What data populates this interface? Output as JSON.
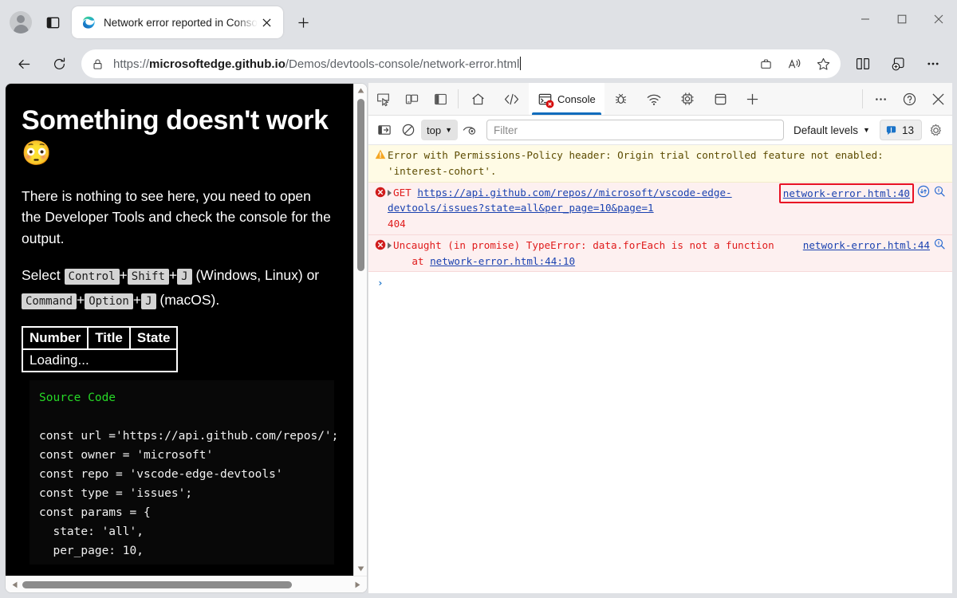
{
  "browser": {
    "profile_icon": "profile-avatar-icon",
    "tab_search_icon": "tab-panel-icon",
    "tab": {
      "favicon": "edge-logo-icon",
      "title": "Network error reported in Conso",
      "close_icon": "close-icon"
    },
    "new_tab_label": "+",
    "window_controls": {
      "minimize": "minimize-icon",
      "maximize": "maximize-icon",
      "close": "close-icon"
    },
    "nav": {
      "back_icon": "back-arrow-icon",
      "reload_icon": "reload-icon",
      "lock_icon": "lock-icon",
      "url_full": "https://microsoftedge.github.io/Demos/devtools-console/network-error.html",
      "url_scheme": "https://",
      "url_domain": "microsoftedge.github.io",
      "url_path": "/Demos/devtools-console/network-error.html",
      "briefcase_icon": "briefcase-icon",
      "read_aloud_icon": "read-aloud-icon",
      "favorite_icon": "star-icon",
      "split_screen_icon": "split-screen-icon",
      "collections_icon": "collections-icon",
      "settings_more_icon": "more-ellipsis-icon"
    }
  },
  "page": {
    "heading": "Something doesn't work",
    "heading_emoji": "😳",
    "paragraph": "There is nothing to see here, you need to open the Developer Tools and check the console for the output.",
    "shortcut_prefix": "Select",
    "keys_windows": [
      "Control",
      "Shift",
      "J"
    ],
    "platform_windows": "(Windows, Linux)",
    "shortcut_or": "or",
    "keys_mac": [
      "Command",
      "Option",
      "J"
    ],
    "platform_mac": "(macOS).",
    "table": {
      "headers": [
        "Number",
        "Title",
        "State"
      ],
      "loading_row": "Loading..."
    },
    "source_code_label": "Source Code",
    "source_code": "const url ='https://api.github.com/repos/';\nconst owner = 'microsoft'\nconst repo = 'vscode-edge-devtools'\nconst type = 'issues';\nconst params = {\n  state: 'all',\n  per_page: 10,"
  },
  "devtools": {
    "left_tools": [
      {
        "name": "inspect-element-icon",
        "label": "Inspect"
      },
      {
        "name": "device-emulation-icon",
        "label": "Device emulation"
      },
      {
        "name": "toggle-sidebar-icon",
        "label": "Toggle sidebar"
      }
    ],
    "tabs": [
      {
        "name": "tab-welcome",
        "icon": "home-icon",
        "label": ""
      },
      {
        "name": "tab-elements",
        "icon": "code-icon",
        "label": ""
      },
      {
        "name": "tab-console",
        "icon": "console-icon",
        "label": "Console",
        "selected": true,
        "badge": "error"
      },
      {
        "name": "tab-sources",
        "icon": "bug-icon",
        "label": ""
      },
      {
        "name": "tab-network",
        "icon": "network-icon",
        "label": ""
      },
      {
        "name": "tab-performance",
        "icon": "cpu-icon",
        "label": ""
      },
      {
        "name": "tab-application",
        "icon": "application-icon",
        "label": ""
      },
      {
        "name": "tab-more-panels",
        "icon": "plus-icon",
        "label": ""
      }
    ],
    "tabbar_right": [
      {
        "name": "more-tools-icon",
        "label": "..."
      },
      {
        "name": "help-icon",
        "label": "?"
      },
      {
        "name": "close-devtools-icon",
        "label": "X"
      }
    ],
    "filterbar": {
      "sidebar_toggle_icon": "console-sidebar-icon",
      "clear_console_icon": "clear-console-icon",
      "context_value": "top",
      "context_caret": "▼",
      "live_expression_icon": "eye-icon",
      "filter_placeholder": "Filter",
      "filter_value": "",
      "levels_label": "Default levels",
      "levels_caret": "▼",
      "issues_icon": "issues-bubble-icon",
      "issues_count": "13",
      "settings_icon": "gear-icon"
    },
    "messages": [
      {
        "type": "warning",
        "icon": "warning-triangle-icon",
        "text": "Error with Permissions-Policy header: Origin trial controlled feature not enabled: 'interest-cohort'.",
        "source": "",
        "boxed": false
      },
      {
        "type": "error",
        "icon": "error-circle-icon",
        "method": "GET",
        "url": "https://api.github.com/repos//microsoft/vscode-edge-devtools/issues?state=all&per_page=10&page=1",
        "status": "404",
        "source": "network-error.html:40",
        "boxed": true,
        "info_icon": "network-info-icon",
        "search_icon": "search-issue-icon"
      },
      {
        "type": "error",
        "icon": "error-circle-icon",
        "text": "Uncaught (in promise) TypeError: data.forEach is not a function",
        "stack": "    at network-error.html:44:10",
        "stack_link": "network-error.html:44:10",
        "source": "network-error.html:44",
        "boxed": false,
        "search_icon": "search-issue-icon"
      }
    ],
    "prompt_chevron": "›"
  },
  "colors": {
    "accent": "#0f6cbd",
    "error": "#e01b1b",
    "error_box": "#e81123",
    "warning_bg": "#fffbe5",
    "error_bg": "#fdf0f0",
    "link": "#1a42b0",
    "chrome_bg": "#dfe1e5"
  }
}
